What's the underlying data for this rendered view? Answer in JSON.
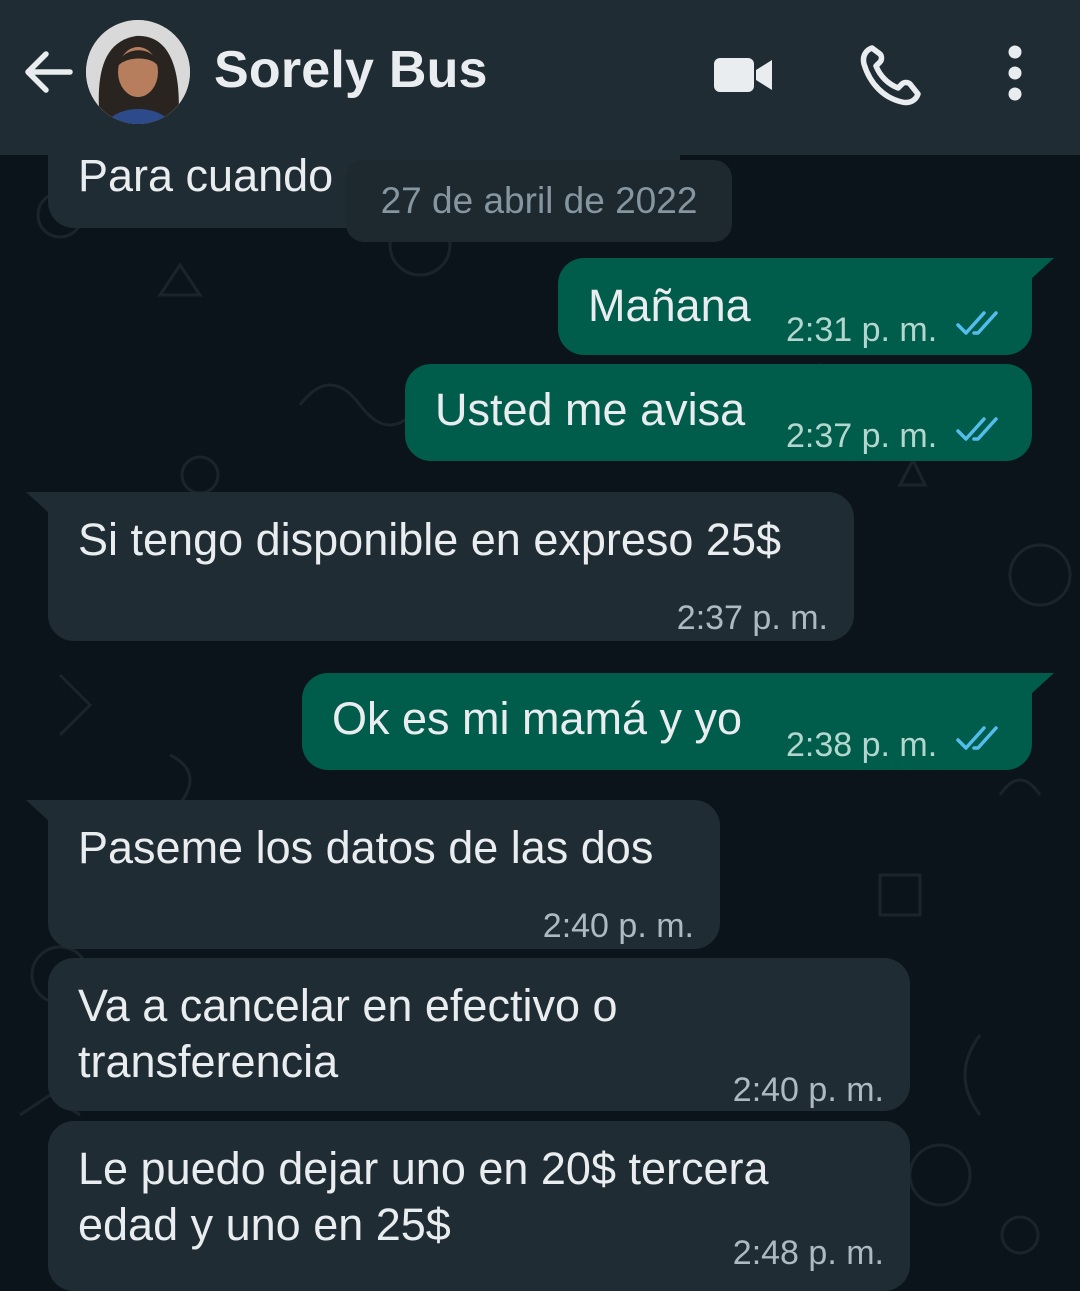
{
  "header": {
    "contact_name": "Sorely Bus",
    "icons": [
      "back-arrow-icon",
      "video-camera-icon",
      "phone-icon",
      "more-vertical-icon"
    ]
  },
  "date_chip": "27 de abril de 2022",
  "messages": [
    {
      "direction": "incoming",
      "text": "Para cuando",
      "time": ""
    },
    {
      "direction": "outgoing",
      "text": "Mañana",
      "time": "2:31 p. m.",
      "status": "read"
    },
    {
      "direction": "outgoing",
      "text": "Usted me avisa",
      "time": "2:37 p. m.",
      "status": "read"
    },
    {
      "direction": "incoming",
      "text": "Si tengo disponible en expreso 25$",
      "time": "2:37 p. m."
    },
    {
      "direction": "outgoing",
      "text": "Ok es mi mamá y yo",
      "time": "2:38 p. m.",
      "status": "read"
    },
    {
      "direction": "incoming",
      "text": "Paseme los datos de las dos",
      "time": "2:40 p. m."
    },
    {
      "direction": "incoming",
      "lines": [
        "Va a cancelar en efectivo o",
        "transferencia"
      ],
      "time": "2:40 p. m."
    },
    {
      "direction": "incoming",
      "lines": [
        "Le puedo dejar uno en 20$ tercera",
        "edad y uno en 25$"
      ],
      "time": "2:48 p. m."
    }
  ],
  "colors": {
    "background": "#0b141a",
    "header": "#1f2c34",
    "incoming_bubble": "#202c33",
    "outgoing_bubble": "#005c4b",
    "read_ticks": "#53bdeb"
  }
}
